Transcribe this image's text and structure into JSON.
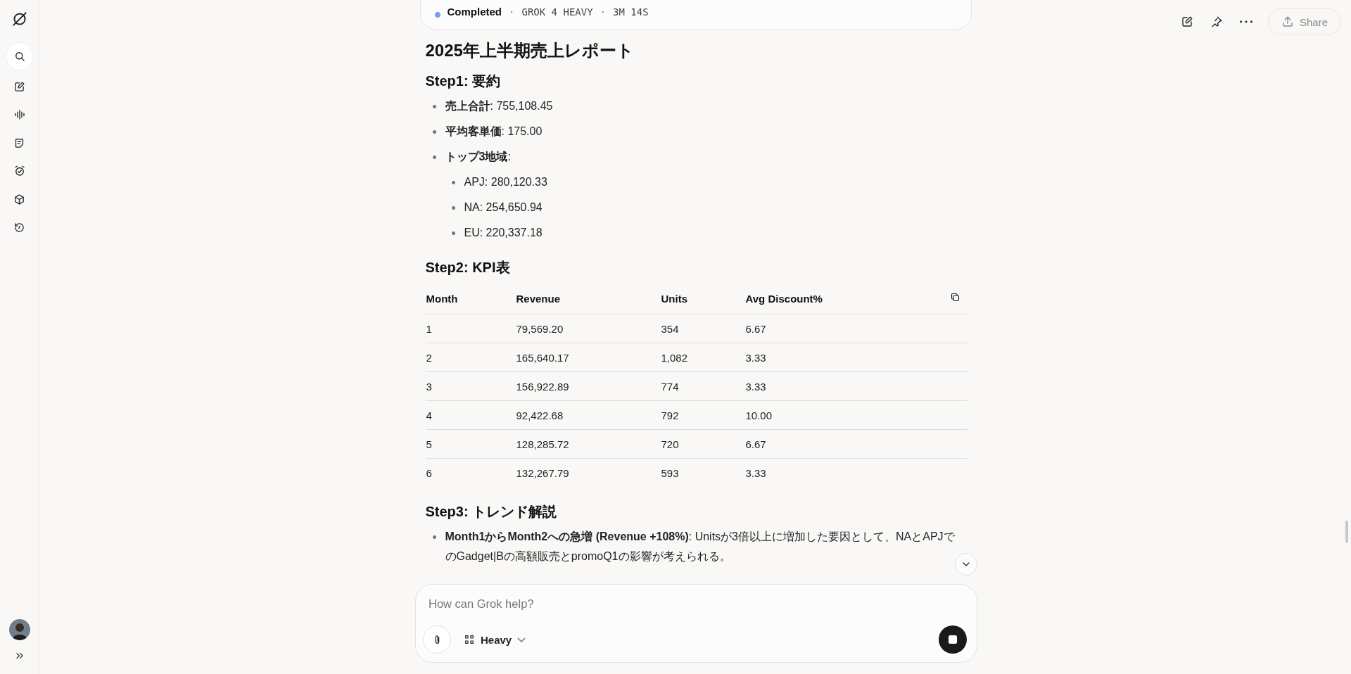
{
  "status": {
    "label": "Completed",
    "separator": "·",
    "model": "GROK 4 HEAVY",
    "duration": "3M 14S"
  },
  "toolbar": {
    "share": "Share"
  },
  "report": {
    "title": "2025年上半期売上レポート",
    "sections": [
      {
        "kind": "bullets",
        "heading": "Step1: 要約",
        "items": [
          {
            "text": "**売上合計**: 755,108.45"
          },
          {
            "text": "**平均客単価**: 175.00"
          },
          {
            "text": "**トップ3地域**:",
            "children": [
              {
                "text": "APJ: 280,120.33"
              },
              {
                "text": "NA: 254,650.94"
              },
              {
                "text": "EU: 220,337.18"
              }
            ]
          }
        ]
      },
      {
        "kind": "table",
        "heading": "Step2: KPI表",
        "columns": [
          "Month",
          "Revenue",
          "Units",
          "Avg Discount%"
        ],
        "rows": [
          [
            "1",
            "79,569.20",
            "354",
            "6.67"
          ],
          [
            "2",
            "165,640.17",
            "1,082",
            "3.33"
          ],
          [
            "3",
            "156,922.89",
            "774",
            "3.33"
          ],
          [
            "4",
            "92,422.68",
            "792",
            "10.00"
          ],
          [
            "5",
            "128,285.72",
            "720",
            "6.67"
          ],
          [
            "6",
            "132,267.79",
            "593",
            "3.33"
          ]
        ]
      },
      {
        "kind": "bullets",
        "heading": "Step3: トレンド解説",
        "items": [
          {
            "text": "**Month1からMonth2への急増 (Revenue +108%)**: Unitsが3倍以上に増加した要因として、NAとAPJでのGadget|Bの高額販売とpromoQ1の影響が考えられる。"
          }
        ]
      }
    ]
  },
  "composer": {
    "placeholder": "How can Grok help?",
    "mode": "Heavy"
  }
}
